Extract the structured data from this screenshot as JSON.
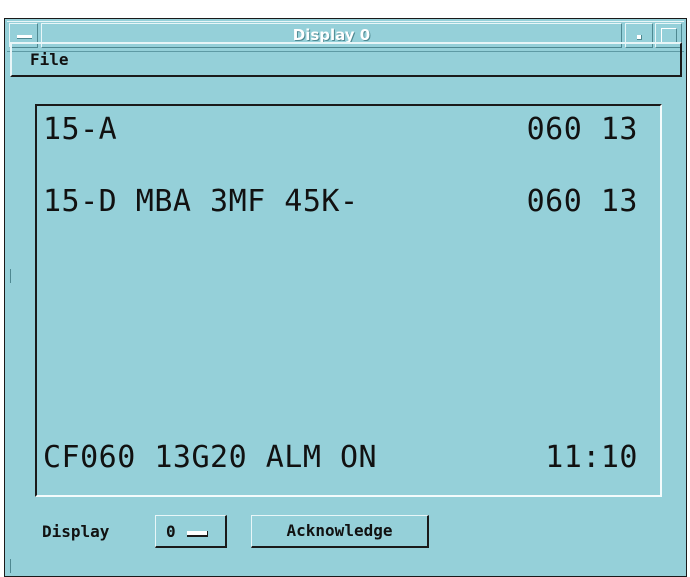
{
  "window": {
    "title": "Display 0"
  },
  "menubar": {
    "items": [
      {
        "label": "File"
      }
    ]
  },
  "screen": {
    "lines": [
      {
        "left": "15-A",
        "right": "060 13"
      },
      {
        "left": "15-D MBA 3MF 45K-",
        "right": "060 13"
      }
    ],
    "status": {
      "left": "CF060 13G20 ALM ON",
      "right": "11:10"
    }
  },
  "controls": {
    "display_label": "Display",
    "display_value": "0",
    "acknowledge_label": "Acknowledge"
  },
  "colors": {
    "background": "#95d0d9",
    "title_text": "#ffffff",
    "text": "#111111"
  }
}
